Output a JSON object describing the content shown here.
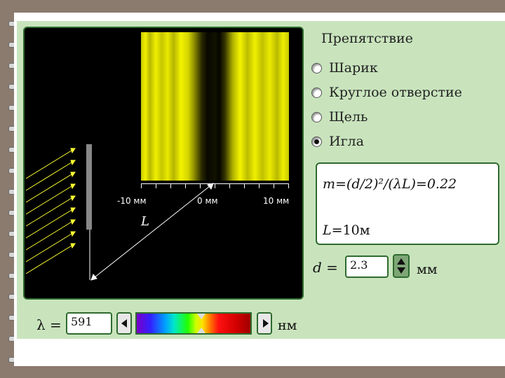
{
  "obstacle": {
    "title": "Препятствие",
    "options": [
      {
        "label": "Шарик",
        "selected": false
      },
      {
        "label": "Круглое отверстие",
        "selected": false
      },
      {
        "label": "Щель",
        "selected": false
      },
      {
        "label": "Игла",
        "selected": true
      }
    ]
  },
  "simulation": {
    "axis_labels": [
      "-10 мм",
      "0 мм",
      "10 мм"
    ],
    "distance_label": "L",
    "pattern_color": "#e6e600"
  },
  "formula": {
    "line1": "m=(d/2)²/(λL)=0.22",
    "l_symbol": "L",
    "l_value": "=10м"
  },
  "diameter": {
    "symbol": "d",
    "eq": "=",
    "value": "2.3",
    "unit": "мм"
  },
  "wavelength": {
    "symbol": "λ",
    "eq": "=",
    "value": "591",
    "unit": "нм"
  },
  "colors": {
    "panel_bg": "#c9e4bd",
    "border": "#2e6b2e",
    "screen_bg": "#000000"
  }
}
